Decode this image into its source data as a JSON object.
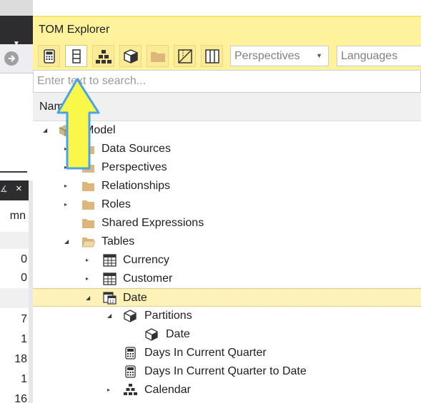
{
  "left_panel": {
    "column_header": "mn",
    "values": [
      "0",
      "0",
      "7",
      "1",
      "18",
      "1",
      "16"
    ]
  },
  "tom": {
    "title": "TOM Explorer",
    "toolbar": {
      "buttons": [
        {
          "name": "measure-icon"
        },
        {
          "name": "column-icon"
        },
        {
          "name": "hierarchy-icon"
        },
        {
          "name": "partition-icon"
        },
        {
          "name": "folder-icon"
        },
        {
          "name": "perspective-icon"
        },
        {
          "name": "table-icon"
        }
      ],
      "perspectives_placeholder": "Perspectives",
      "languages_placeholder": "Languages"
    },
    "search_placeholder": "Enter text to search...",
    "column_header": "Name",
    "tree": [
      {
        "label": "Model",
        "icon": "model-icon",
        "expander": "expanded"
      },
      {
        "label": "Data Sources",
        "icon": "folder-icon",
        "expander": "collapsed"
      },
      {
        "label": "Perspectives",
        "icon": "folder-icon",
        "expander": "collapsed"
      },
      {
        "label": "Relationships",
        "icon": "folder-icon",
        "expander": "collapsed"
      },
      {
        "label": "Roles",
        "icon": "folder-icon",
        "expander": "collapsed"
      },
      {
        "label": "Shared Expressions",
        "icon": "folder-icon",
        "expander": "none"
      },
      {
        "label": "Tables",
        "icon": "folder-open-icon",
        "expander": "expanded"
      },
      {
        "label": "Currency",
        "icon": "table-icon",
        "expander": "collapsed"
      },
      {
        "label": "Customer",
        "icon": "table-icon",
        "expander": "collapsed"
      },
      {
        "label": "Date",
        "icon": "date-table-icon",
        "expander": "expanded",
        "selected": true
      },
      {
        "label": "Partitions",
        "icon": "partition-icon",
        "expander": "expanded"
      },
      {
        "label": "Date",
        "icon": "partition-icon",
        "expander": "none"
      },
      {
        "label": "Days In Current Quarter",
        "icon": "measure-icon",
        "expander": "none"
      },
      {
        "label": "Days In Current Quarter to Date",
        "icon": "measure-icon",
        "expander": "none"
      },
      {
        "label": "Calendar",
        "icon": "hierarchy-icon",
        "expander": "collapsed"
      }
    ]
  },
  "colors": {
    "accent_yellow": "#fff29d",
    "selected_row": "#fff2b8",
    "arrow_fill": "#f9f74a",
    "arrow_stroke": "#4aa3ea",
    "dark_chrome": "#2d2d30"
  }
}
